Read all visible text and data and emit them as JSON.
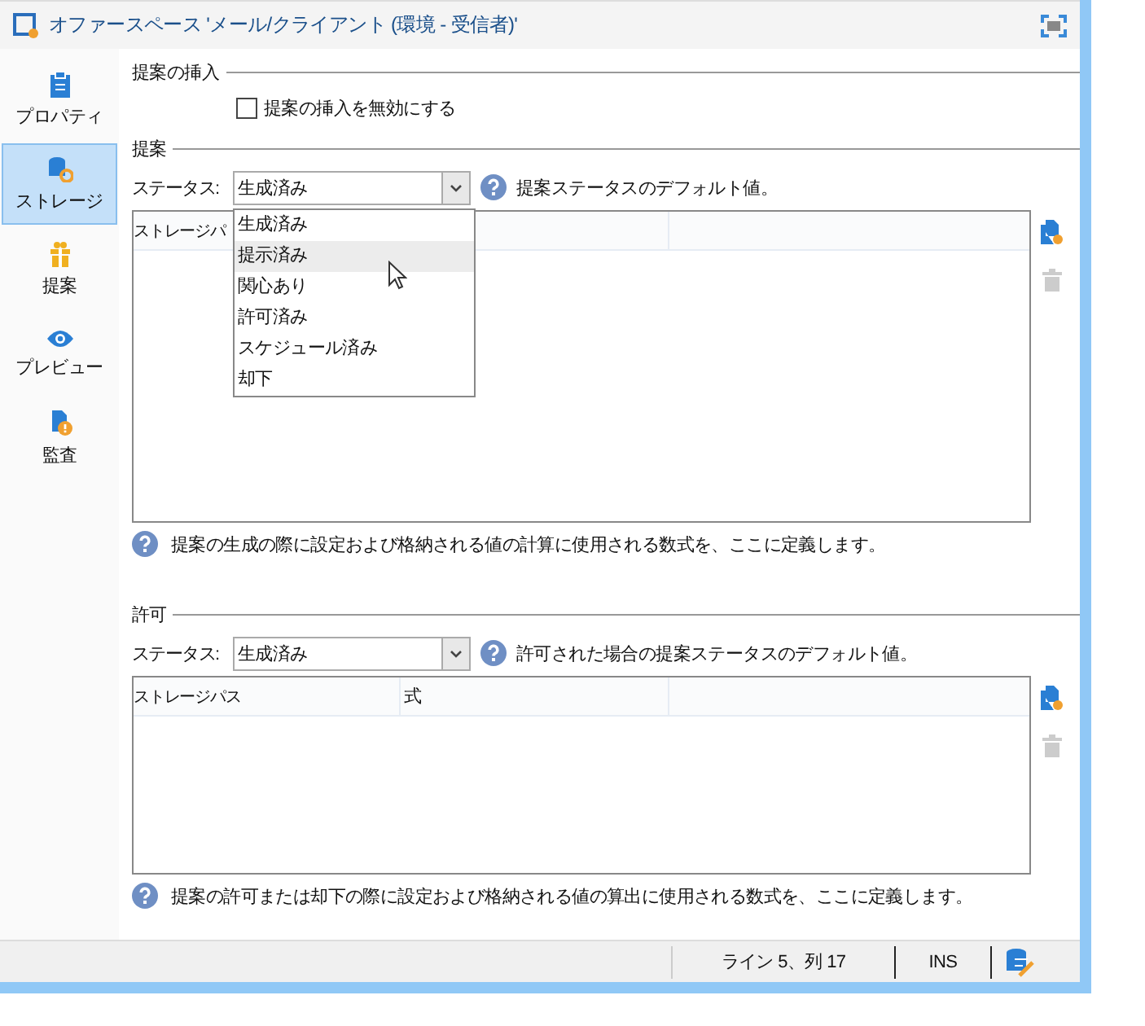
{
  "window": {
    "title": "オファースペース 'メール/クライアント (環境 - 受信者)'"
  },
  "sidebar": {
    "items": [
      {
        "label": "プロパティ",
        "selected": false
      },
      {
        "label": "ストレージ",
        "selected": true
      },
      {
        "label": "提案",
        "selected": false
      },
      {
        "label": "プレビュー",
        "selected": false
      },
      {
        "label": "監査",
        "selected": false
      }
    ]
  },
  "insertion": {
    "title": "提案の挿入",
    "checkbox": {
      "label": "提案の挿入を無効にする",
      "checked": false
    }
  },
  "proposal": {
    "title": "提案",
    "status_label": "ステータス:",
    "status_value": "生成済み",
    "hint": "提案ステータスのデフォルト値。",
    "dropdown": {
      "expanded": true,
      "options": [
        {
          "label": "生成済み",
          "selected": false
        },
        {
          "label": "提示済み",
          "selected": true
        },
        {
          "label": "関心あり",
          "selected": false
        },
        {
          "label": "許可済み",
          "selected": false
        },
        {
          "label": "スケジュール済み",
          "selected": false
        },
        {
          "label": "却下",
          "selected": false
        }
      ]
    },
    "table": {
      "columns": [
        "ストレージパ"
      ]
    },
    "note": "提案の生成の際に設定および格納される値の計算に使用される数式を、ここに定義します。"
  },
  "approval": {
    "title": "許可",
    "status_label": "ステータス:",
    "status_value": "生成済み",
    "hint": "許可された場合の提案ステータスのデフォルト値。",
    "table": {
      "columns": [
        "ストレージパス",
        "式"
      ]
    },
    "note": "提案の許可または却下の際に設定および格納される値の算出に使用される数式を、ここに定義します。"
  },
  "status_bar": {
    "position": "ライン 5、列 17",
    "mode": "INS"
  }
}
